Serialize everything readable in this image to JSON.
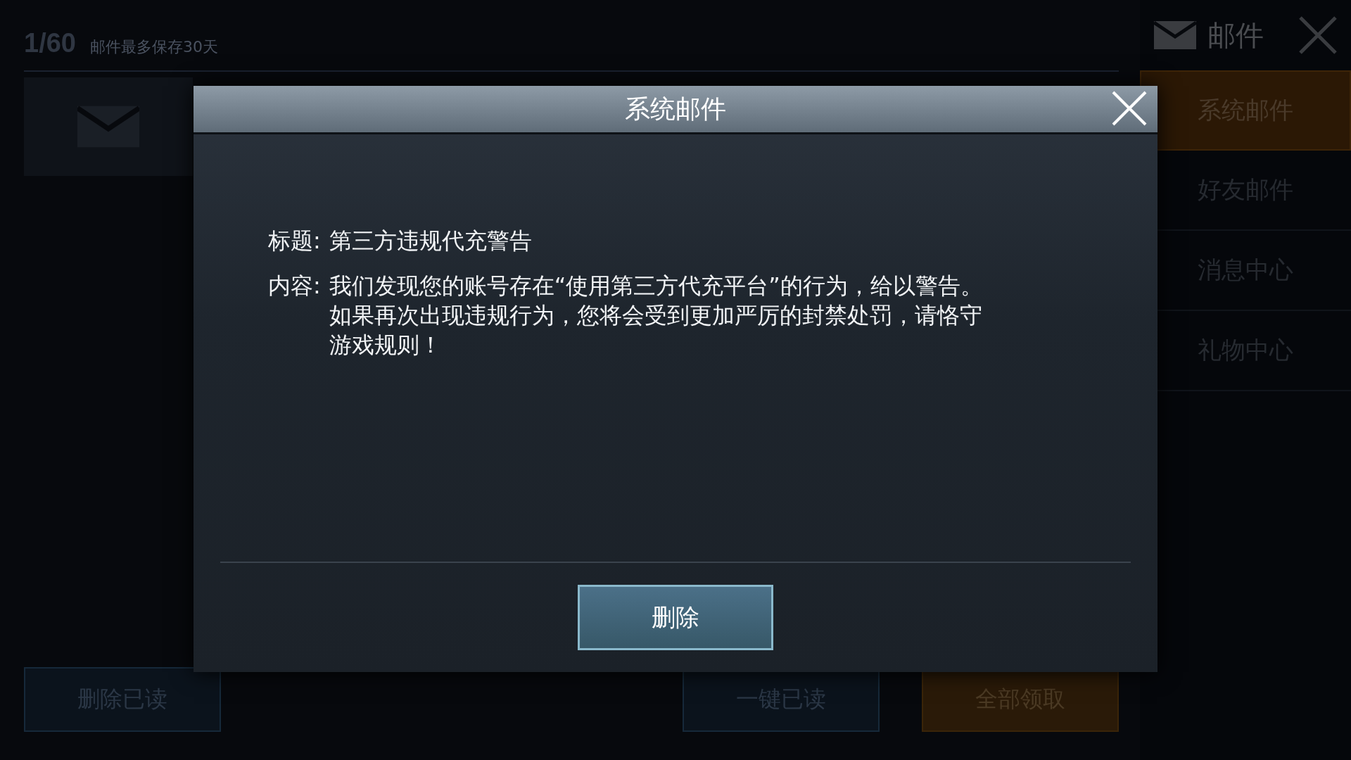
{
  "mailbox": {
    "count": "1/60",
    "note": "邮件最多保存30天",
    "header": "邮件",
    "tabs": [
      {
        "label": "系统邮件",
        "selected": true
      },
      {
        "label": "好友邮件",
        "selected": false
      },
      {
        "label": "消息中心",
        "selected": false
      },
      {
        "label": "礼物中心",
        "selected": false
      }
    ],
    "actions": [
      {
        "label": "删除已读",
        "kind": "plain"
      },
      {
        "label": "一键已读",
        "kind": "plain"
      },
      {
        "label": "全部领取",
        "kind": "primary"
      }
    ]
  },
  "dialog": {
    "title": "系统邮件",
    "fields": [
      {
        "label": "标题:",
        "value": "第三方违规代充警告"
      },
      {
        "label": "内容:",
        "value": "我们发现您的账号存在“使用第三方代充平台”的行为，给以警告。如果再次出现违规行为，您将会受到更加严厉的封禁处罚，请恪守游戏规则！"
      }
    ],
    "button": "删除"
  }
}
